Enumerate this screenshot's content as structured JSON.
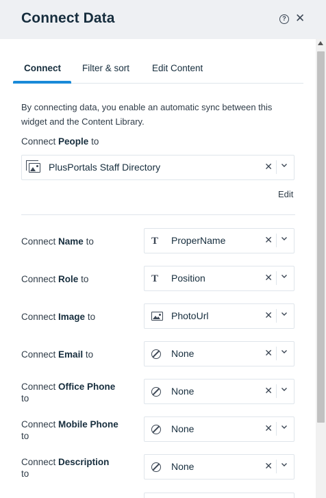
{
  "panel": {
    "title": "Connect Data",
    "help_glyph": "?",
    "close_glyph": "✕"
  },
  "tabs": [
    {
      "label": "Connect",
      "active": true
    },
    {
      "label": "Filter & sort",
      "active": false
    },
    {
      "label": "Edit Content",
      "active": false
    }
  ],
  "intro_text": "By connecting data, you enable an automatic sync between this widget and the Content Library.",
  "collection": {
    "label_prefix": "Connect ",
    "label_bold": "People",
    "label_suffix": " to",
    "value": "PlusPortals Staff Directory",
    "icon": "collection-icon",
    "edit_label": "Edit"
  },
  "fields": [
    {
      "prefix": "Connect ",
      "bold": "Name",
      "suffix": " to",
      "value": "ProperName",
      "icon": "text-icon"
    },
    {
      "prefix": "Connect ",
      "bold": "Role",
      "suffix": " to",
      "value": "Position",
      "icon": "text-icon"
    },
    {
      "prefix": "Connect ",
      "bold": "Image",
      "suffix": " to",
      "value": "PhotoUrl",
      "icon": "image-icon"
    },
    {
      "prefix": "Connect ",
      "bold": "Email",
      "suffix": " to",
      "value": "None",
      "icon": "none-icon"
    },
    {
      "prefix": "Connect ",
      "bold": "Office Phone",
      "suffix": "to",
      "value": "None",
      "icon": "none-icon"
    },
    {
      "prefix": "Connect ",
      "bold": "Mobile Phone",
      "suffix": "to",
      "value": "None",
      "icon": "none-icon"
    },
    {
      "prefix": "Connect ",
      "bold": "Description",
      "suffix": "to",
      "value": "None",
      "icon": "none-icon"
    }
  ],
  "glyphs": {
    "clear": "✕",
    "text_t": "T"
  },
  "colors": {
    "accent": "#1a8ad8",
    "header_bg": "#eef0f3",
    "text": "#162d3d"
  }
}
